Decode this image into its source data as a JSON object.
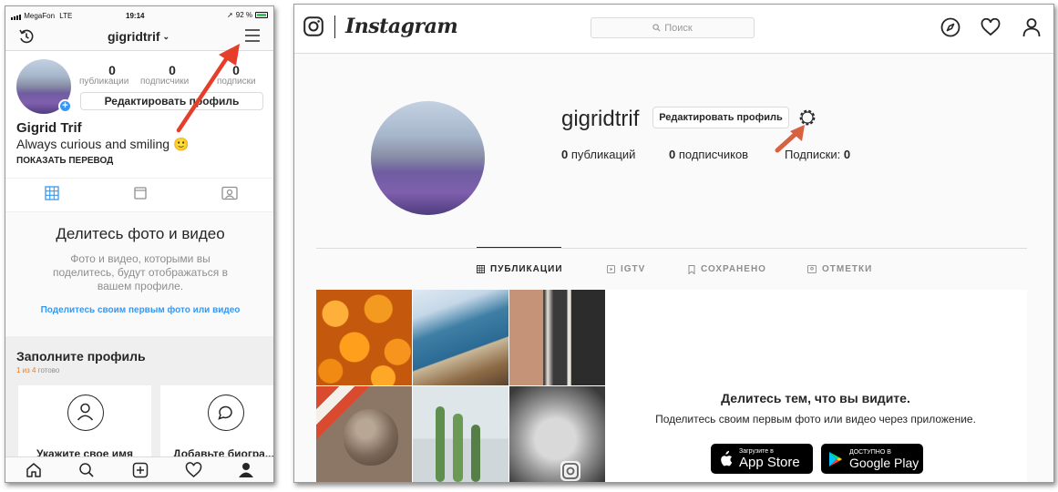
{
  "phone": {
    "status": {
      "carrier": "MegaFon",
      "network": "LTE",
      "time": "19:14",
      "battery": "92 %"
    },
    "header": {
      "username": "gigridtrif"
    },
    "stats": [
      {
        "value": "0",
        "label": "публикации"
      },
      {
        "value": "0",
        "label": "подписчики"
      },
      {
        "value": "0",
        "label": "подписки"
      }
    ],
    "edit_button": "Редактировать профиль",
    "name": "Gigrid Trif",
    "bio": "Always curious and smiling 🙂",
    "translate": "ПОКАЗАТЬ ПЕРЕВОД",
    "empty": {
      "title": "Делитесь фото и видео",
      "body_lines": [
        "Фото и видео, которыми вы",
        "поделитесь, будут отображаться в",
        "вашем профиле."
      ],
      "link": "Поделитесь своим первым фото или видео"
    },
    "complete": {
      "title": "Заполните профиль",
      "progress_done": "1 из 4",
      "progress_word": "готово",
      "cards": [
        {
          "label": "Укажите свое имя"
        },
        {
          "label": "Добавьте биогра..."
        }
      ]
    }
  },
  "web": {
    "logo": "Instagram",
    "search_placeholder": "Поиск",
    "username": "gigridtrif",
    "edit_button": "Редактировать профиль",
    "stats": [
      {
        "value": "0",
        "label": "публикаций"
      },
      {
        "value": "0",
        "label": "подписчиков"
      },
      {
        "label": "Подписки:",
        "value": "0"
      }
    ],
    "tabs": [
      {
        "label": "ПУБЛИКАЦИИ",
        "active": true
      },
      {
        "label": "IGTV",
        "active": false
      },
      {
        "label": "СОХРАНЕНО",
        "active": false
      },
      {
        "label": "ОТМЕТКИ",
        "active": false
      }
    ],
    "promo": {
      "title": "Делитесь тем, что вы видите.",
      "subtitle": "Поделитесь своим первым фото или видео через приложение.",
      "appstore_small": "Загрузите в",
      "appstore_big": "App Store",
      "google_small": "ДОСТУПНО В",
      "google_big": "Google Play"
    }
  },
  "colors": {
    "accent_link": "#3897f0",
    "arrow": "#e53e2a",
    "progress": "#ee7a1c"
  }
}
